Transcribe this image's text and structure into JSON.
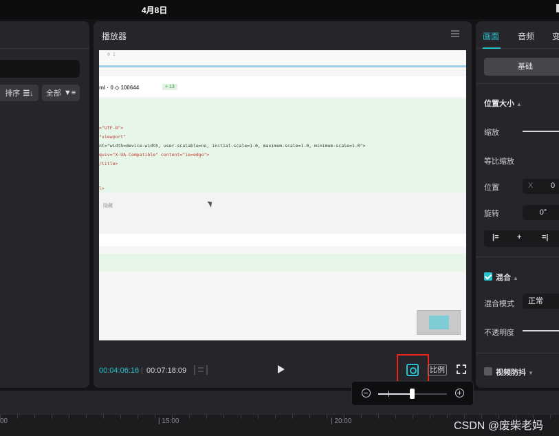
{
  "topbar": {
    "date": "4月8日"
  },
  "left_panel": {
    "sort_label": "排序",
    "all_label": "全部"
  },
  "player": {
    "title": "播放器",
    "current_time": "00:04:06:16",
    "total_time": "00:07:18:09",
    "ratio_label": "比例",
    "preview": {
      "line_numbers": "0 1",
      "file_meta": "ml · 0 ◇ 100644",
      "diff_badge": "+ 13",
      "code_lines": [
        "=\"UTF-8\">",
        "\"viewport\"",
        "nt=\"width=device-width, user-scalable=no, initial-scale=1.0, maximum-scale=1.0, minimum-scale=1.0\">",
        "quiv=\"X-UA-Compatible\" content=\"ie=edge\">",
        "/title>",
        "l>"
      ],
      "small_text": "隐藏"
    }
  },
  "right_panel": {
    "tabs": [
      "画面",
      "音频",
      "变"
    ],
    "basic_label": "基础",
    "section_position_size": "位置大小",
    "scale_label": "缩放",
    "uniform_scale_label": "等比缩放",
    "position_label": "位置",
    "position_axis": "X",
    "position_value": "0",
    "rotation_label": "旋转",
    "rotation_value": "0°",
    "blend_section": "混合",
    "blend_mode_label": "混合模式",
    "blend_mode_value": "正常",
    "opacity_label": "不透明度",
    "stabilize_label": "视频防抖"
  },
  "timeline": {
    "ticks": [
      "00",
      "| 15:00",
      "| 20:00"
    ]
  },
  "zoom_popup": {
    "level": 0.5
  },
  "watermark": "CSDN @废柴老妈",
  "colors": {
    "accent": "#27c4cf",
    "highlight_box": "#e8261c",
    "panel": "#26262a"
  }
}
